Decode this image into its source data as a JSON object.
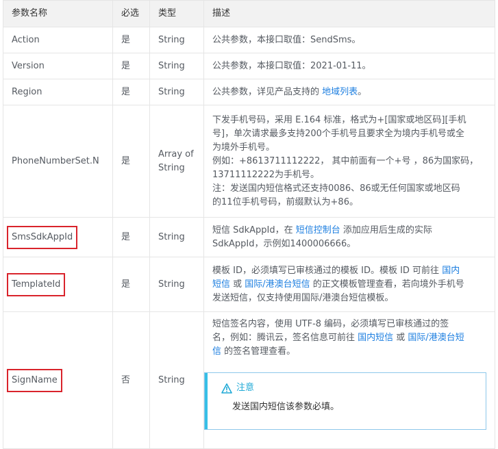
{
  "headers": [
    "参数名称",
    "必选",
    "类型",
    "描述"
  ],
  "rows": [
    {
      "name": "Action",
      "required": "是",
      "type": "String",
      "desc": "公共参数，本接口取值：SendSms。"
    },
    {
      "name": "Version",
      "required": "是",
      "type": "String",
      "desc": "公共参数，本接口取值：2021-01-11。"
    },
    {
      "name": "Region",
      "required": "是",
      "type": "String",
      "desc_prefix": "公共参数，详见产品支持的 ",
      "desc_link": "地域列表",
      "desc_suffix": "。"
    },
    {
      "name": "PhoneNumberSet.N",
      "required": "是",
      "type_line1": "Array of",
      "type_line2": "String",
      "desc_lines": [
        "下发手机号码，采用 E.164 标准，格式为+[国家或地区码][手机",
        "号]，单次请求最多支持200个手机号且要求全为境内手机号或全",
        "为境外手机号。",
        "例如：+8613711112222， 其中前面有一个+号 ，86为国家码，",
        "13711112222为手机号。",
        "注：发送国内短信格式还支持0086、86或无任何国家或地区码",
        "的11位手机号码，前缀默认为+86。"
      ]
    },
    {
      "name": "SmsSdkAppId",
      "required": "是",
      "type": "String",
      "desc_a": "短信 SdkAppId，在 ",
      "desc_link": "短信控制台",
      "desc_b": " 添加应用后生成的实际",
      "desc_c": "SdkAppId，示例如1400006666。"
    },
    {
      "name": "TemplateId",
      "required": "是",
      "type": "String",
      "desc_a": "模板 ID，必须填写已审核通过的模板 ID。模板 ID 可前往 ",
      "desc_link1a": "国内",
      "desc_link1b": "短信",
      "desc_b": " 或 ",
      "desc_link2": "国际/港澳台短信",
      "desc_c": " 的正文模板管理查看，若向境外手机号",
      "desc_d": "发送短信，仅支持使用国际/港澳台短信模板。"
    },
    {
      "name": "SignName",
      "required": "否",
      "type": "String",
      "desc_a": "短信签名内容，使用 UTF-8 编码，必须填写已审核通过的签",
      "desc_b": "名，例如：腾讯云，签名信息可前往 ",
      "desc_link1": "国内短信",
      "desc_c": " 或 ",
      "desc_link2a": "国际/港澳台短",
      "desc_link2b": "信",
      "desc_d": " 的签名管理查看。",
      "notice_title": "注意",
      "notice_text": "发送国内短信该参数必填。"
    }
  ],
  "colors": {
    "highlight_box": "#d9232b",
    "link": "#1e7fe0",
    "notice_accent": "#36bfe6"
  }
}
